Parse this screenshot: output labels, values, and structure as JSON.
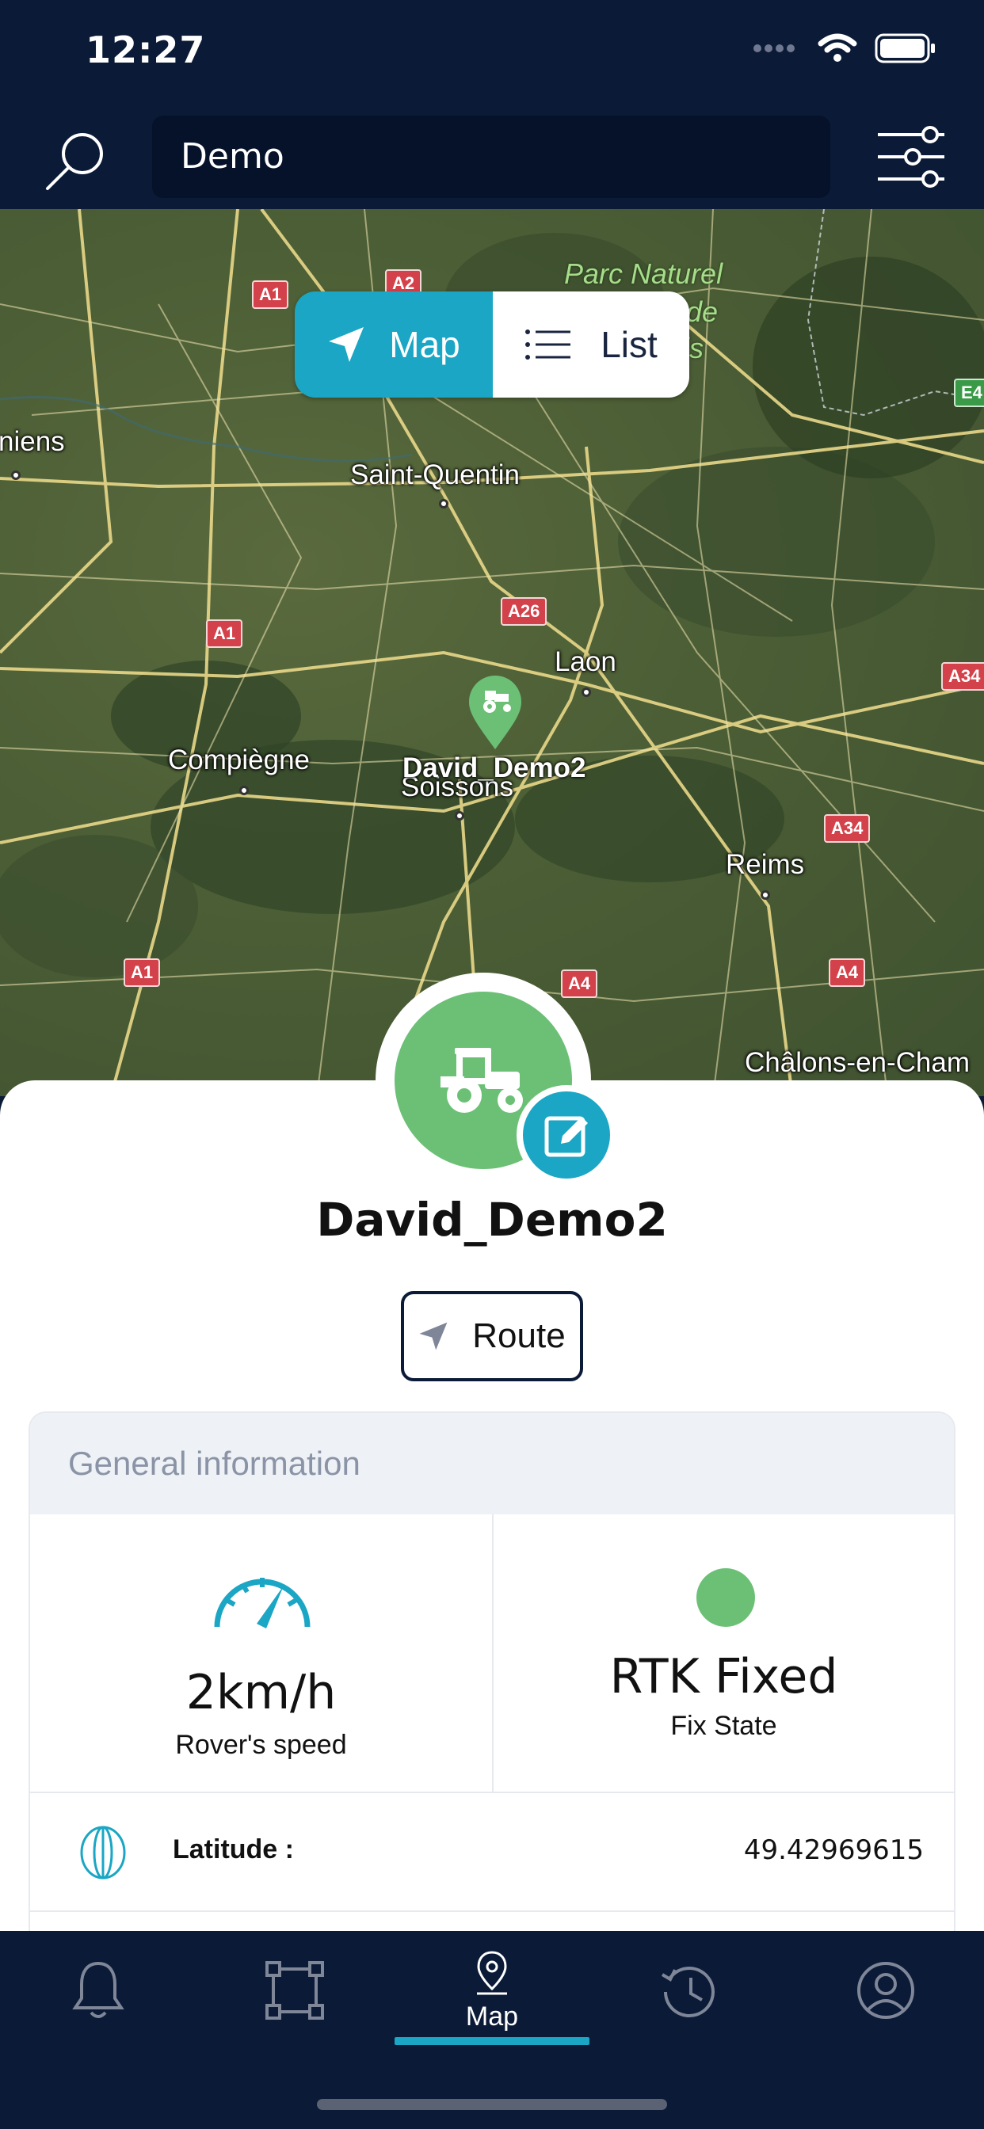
{
  "status_bar": {
    "time": "12:27"
  },
  "search": {
    "value": "Demo"
  },
  "map": {
    "toggle": {
      "map_label": "Map",
      "list_label": "List",
      "active": "Map"
    },
    "park_label": [
      "Parc Naturel",
      "de",
      "is"
    ],
    "road_badges": [
      "A1",
      "A2",
      "A1",
      "A26",
      "A1",
      "A4",
      "A4",
      "A34",
      "A34",
      "E4"
    ],
    "cities": [
      "niens",
      "Saint-Quentin",
      "Laon",
      "Compiègne",
      "Soissons",
      "Reims",
      "Châlons-en-Cham"
    ],
    "marker": {
      "label": "David_Demo2",
      "color": "#6cc076"
    }
  },
  "device": {
    "name": "David_Demo2",
    "route_label": "Route"
  },
  "general_info": {
    "title": "General information",
    "speed_value": "2km/h",
    "speed_label": "Rover's speed",
    "fix_value": "RTK Fixed",
    "fix_label": "Fix State",
    "fix_color": "#6cc076",
    "latitude_label": "Latitude :",
    "latitude_value": "49.42969615"
  },
  "tabbar": {
    "items": [
      {
        "icon": "bell-icon",
        "label": ""
      },
      {
        "icon": "area-icon",
        "label": ""
      },
      {
        "icon": "map-pin-icon",
        "label": "Map"
      },
      {
        "icon": "history-icon",
        "label": ""
      },
      {
        "icon": "profile-icon",
        "label": ""
      }
    ],
    "active": "Map"
  },
  "colors": {
    "accent": "#1aa6c4",
    "header": "#0b1a36",
    "marker_green": "#6cc076"
  }
}
